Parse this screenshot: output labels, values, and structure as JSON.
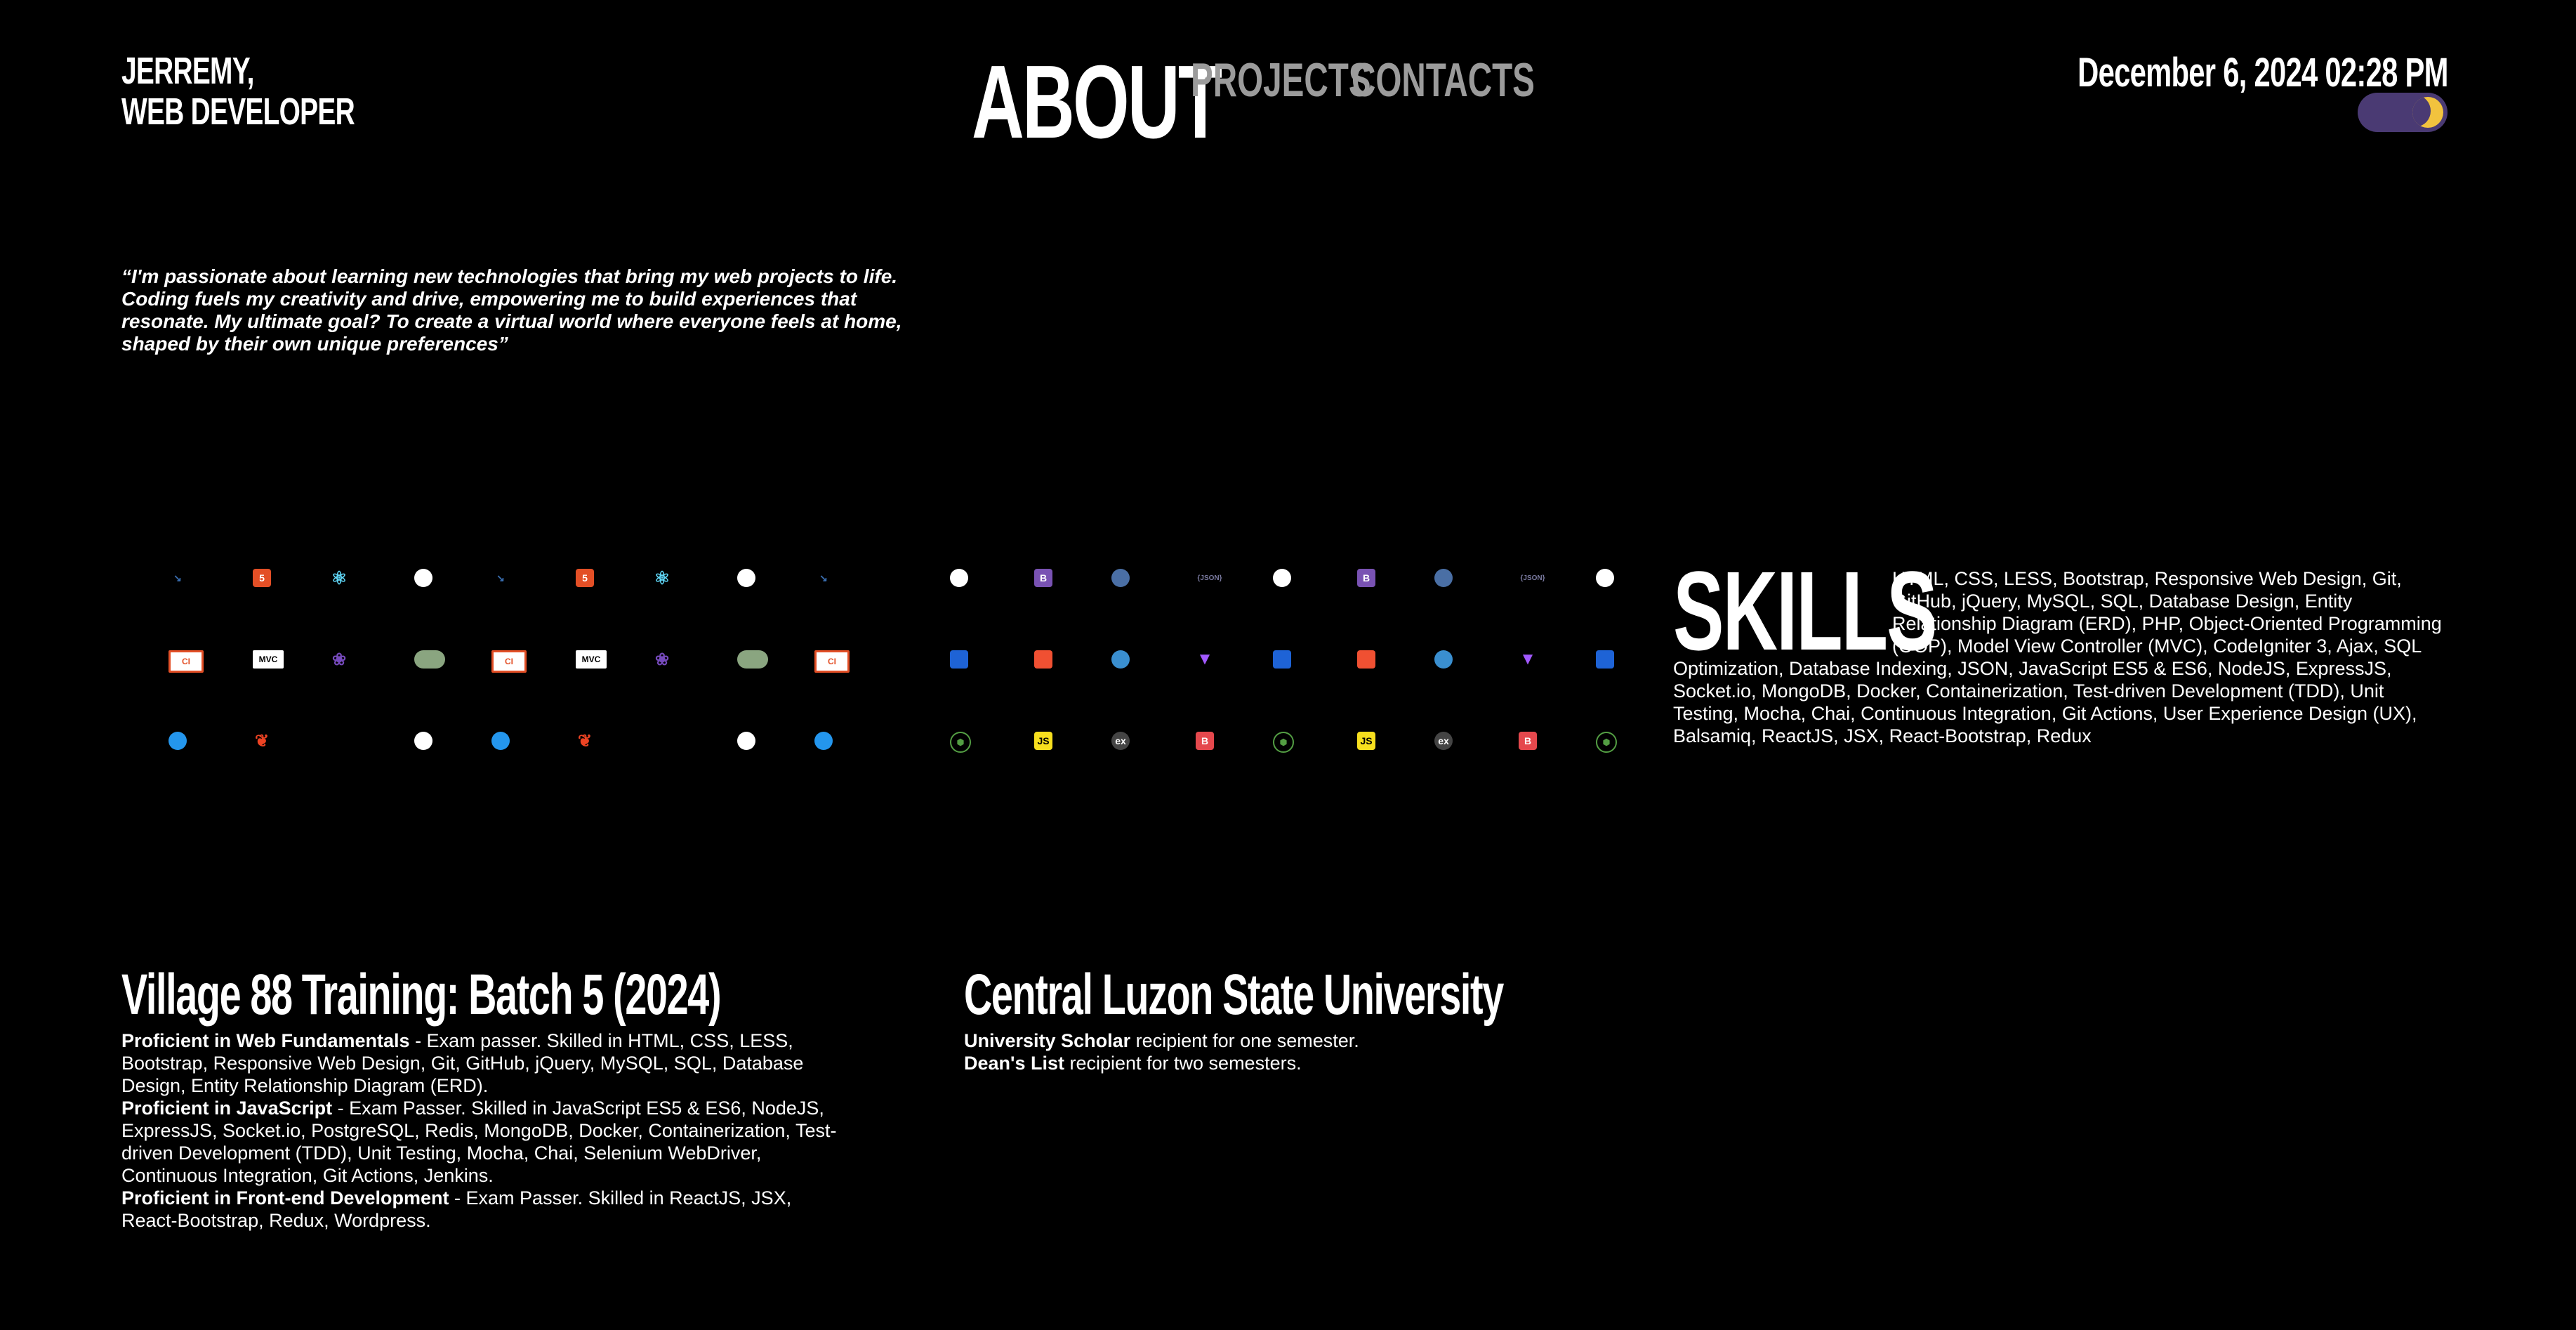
{
  "brand": {
    "line1": "JERREMY,",
    "line2": "WEB DEVELOPER"
  },
  "nav": {
    "about": "ABOUT",
    "projects": "PROJECTS",
    "contacts": "CONTACTS"
  },
  "header": {
    "datetime": "December 6, 2024 02:28 PM",
    "theme_toggle": "dark-mode"
  },
  "quote": "“I'm passionate about learning new technologies that bring my web projects to life. Coding fuels my creativity and drive, empowering me to build experiences that resonate. My ultimate goal? To create a virtual world where everyone feels at home, shaped by their own unique preferences”",
  "skills": {
    "title": "SKILLS",
    "list": "HTML, CSS, LESS, Bootstrap, Responsive Web Design, Git, GitHub, jQuery, MySQL, SQL, Database Design, Entity Relationship Diagram (ERD), PHP, Object-Oriented Programming (OOP), Model View Controller (MVC), CodeIgniter 3, Ajax, SQL Optimization, Database Indexing, JSON, JavaScript ES5 & ES6, NodeJS, ExpressJS, Socket.io, MongoDB, Docker, Containerization, Test-driven Development (TDD), Unit Testing, Mocha, Chai, Continuous Integration, Git Actions, User Experience Design (UX), Balsamiq, ReactJS, JSX, React-Bootstrap, Redux"
  },
  "icons": {
    "left_rows": [
      [
        "ajax-icon",
        "html-icon",
        "react-icon",
        "nodejs-icon",
        "ajax-icon",
        "html-icon",
        "react-icon",
        "nodejs-icon",
        "ajax-icon"
      ],
      [
        "codeigniter-icon",
        "mvc-icon",
        "redux-icon",
        "erd-icon",
        "codeigniter-icon",
        "mvc-icon",
        "redux-icon",
        "erd-icon",
        "codeigniter-icon"
      ],
      [
        "docker-icon",
        "codeigniter-flame-icon",
        "",
        "github-icon",
        "docker-icon",
        "codeigniter-flame-icon",
        "",
        "github-icon",
        "docker-icon"
      ]
    ],
    "right_rows": [
      [
        "github-actions-icon",
        "bootstrap-icon",
        "balsamiq-icon",
        "json-icon",
        "github-actions-icon",
        "bootstrap-icon",
        "balsamiq-icon",
        "json-icon",
        "github-actions-icon"
      ],
      [
        "trello-icon",
        "git-icon",
        "socketio-icon",
        "vite-icon",
        "trello-icon",
        "git-icon",
        "socketio-icon",
        "vite-icon",
        "trello-icon"
      ],
      [
        "nodejs-hex-icon",
        "javascript-icon",
        "express-icon",
        "bootstrap-red-icon",
        "nodejs-hex-icon",
        "javascript-icon",
        "express-icon",
        "bootstrap-red-icon",
        "nodejs-hex-icon"
      ]
    ],
    "labels": {
      "html-icon": "5",
      "mvc-icon": "MVC",
      "json-icon": "{JSON}",
      "javascript-icon": "JS",
      "express-icon": "ex",
      "bootstrap-icon": "B",
      "bootstrap-red-icon": "B"
    },
    "colors": {
      "ajax-icon": "#3a6fb3",
      "html-icon": "#e34f26",
      "react-icon": "#61dafb",
      "nodejs-icon": "#ffffff",
      "codeigniter-icon": "#ffffff",
      "mvc-icon": "#ffffff",
      "redux-icon": "#764abc",
      "erd-icon": "#8aa580",
      "docker-icon": "#2496ed",
      "codeigniter-flame-icon": "#ee4323",
      "github-icon": "#ffffff",
      "github-actions-icon": "#ffffff",
      "bootstrap-icon": "#7952b3",
      "balsamiq-icon": "#4a6fa5",
      "json-icon": "#7a7aa0",
      "trello-icon": "#1e63d6",
      "git-icon": "#f05032",
      "socketio-icon": "#3a8fd0",
      "vite-icon": "#a259ff",
      "nodejs-hex-icon": "#539e43",
      "javascript-icon": "#f7df1e",
      "express-icon": "#444444",
      "bootstrap-red-icon": "#e5484d"
    }
  },
  "education": [
    {
      "title": "Village 88 Training: Batch 5 (2024)",
      "items": [
        {
          "bold": "Proficient in Web Fundamentals",
          "text": " - Exam passer. Skilled in HTML, CSS, LESS, Bootstrap, Responsive Web Design, Git, GitHub, jQuery, MySQL, SQL, Database Design, Entity Relationship Diagram (ERD)."
        },
        {
          "bold": "Proficient in JavaScript",
          "text": " - Exam Passer. Skilled in JavaScript ES5 & ES6, NodeJS, ExpressJS, Socket.io, PostgreSQL, Redis, MongoDB, Docker, Containerization, Test-driven Development (TDD), Unit Testing, Mocha, Chai, Selenium WebDriver, Continuous Integration, Git Actions, Jenkins."
        },
        {
          "bold": "Proficient in Front-end Development",
          "text": " - Exam Passer. Skilled in ReactJS, JSX, React-Bootstrap, Redux, Wordpress."
        }
      ]
    },
    {
      "title": "Central Luzon State University",
      "items": [
        {
          "bold": "University Scholar",
          "text": " recipient for one semester."
        },
        {
          "bold": "Dean's List",
          "text": " recipient for two semesters."
        }
      ]
    }
  ]
}
